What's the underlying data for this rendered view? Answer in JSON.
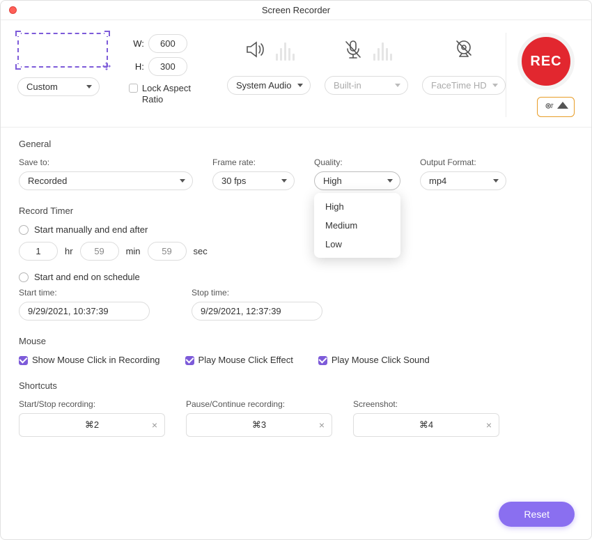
{
  "titlebar": {
    "title": "Screen Recorder"
  },
  "toolbar": {
    "width_label": "W:",
    "width_value": "600",
    "height_label": "H:",
    "height_value": "300",
    "capture_mode": "Custom",
    "lock_aspect_label": "Lock Aspect Ratio",
    "audio_source": "System Audio",
    "mic_source": "Built-in",
    "camera_source": "FaceTime HD",
    "rec_label": "REC"
  },
  "general": {
    "heading": "General",
    "save_to": {
      "label": "Save to:",
      "value": "Recorded"
    },
    "frame_rate": {
      "label": "Frame rate:",
      "value": "30 fps"
    },
    "quality": {
      "label": "Quality:",
      "value": "High",
      "options": [
        "High",
        "Medium",
        "Low"
      ]
    },
    "output_format": {
      "label": "Output Format:",
      "value": "mp4"
    }
  },
  "timer": {
    "heading": "Record Timer",
    "manual_label": "Start manually and end after",
    "hr_value": "1",
    "hr_unit": "hr",
    "min_value": "59",
    "min_unit": "min",
    "sec_value": "59",
    "sec_unit": "sec",
    "schedule_label": "Start and end on schedule",
    "start_time": {
      "label": "Start time:",
      "value": "9/29/2021, 10:37:39"
    },
    "stop_time": {
      "label": "Stop time:",
      "value": "9/29/2021, 12:37:39"
    }
  },
  "mouse": {
    "heading": "Mouse",
    "show_click": "Show Mouse Click in Recording",
    "play_effect": "Play Mouse Click Effect",
    "play_sound": "Play Mouse Click Sound"
  },
  "shortcuts": {
    "heading": "Shortcuts",
    "start_stop": {
      "label": "Start/Stop recording:",
      "value": "⌘2"
    },
    "pause_continue": {
      "label": "Pause/Continue recording:",
      "value": "⌘3"
    },
    "screenshot": {
      "label": "Screenshot:",
      "value": "⌘4"
    }
  },
  "footer": {
    "reset": "Reset"
  }
}
